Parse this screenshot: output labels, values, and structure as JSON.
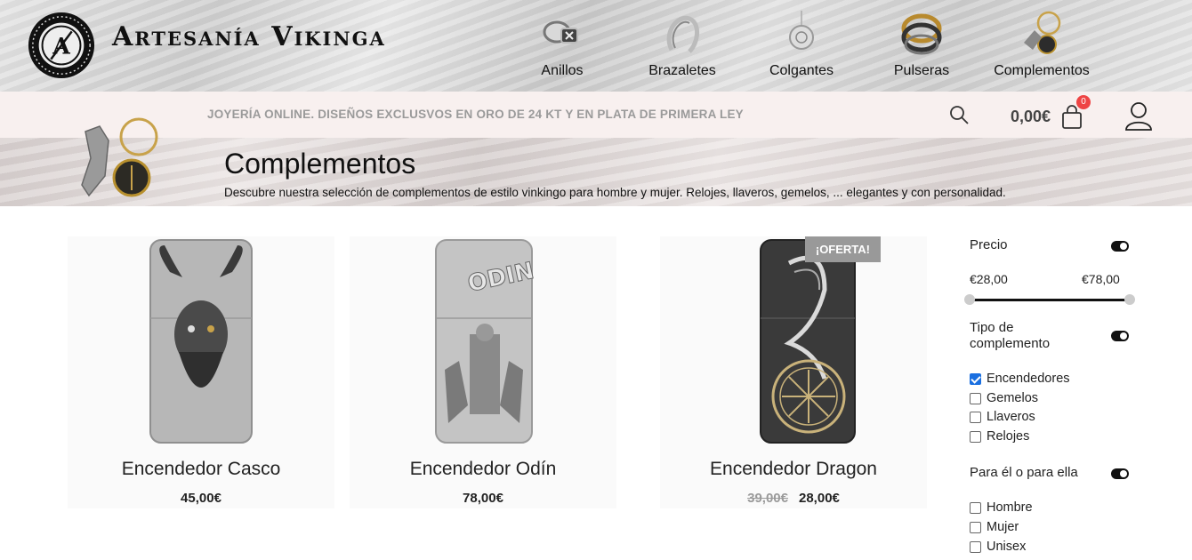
{
  "header": {
    "brand": "Artesanía Vikinga",
    "logo_icon": "viking-medallion-logo",
    "nav": [
      {
        "label": "Anillos",
        "icon": "rings-icon"
      },
      {
        "label": "Brazaletes",
        "icon": "bracelet-icon"
      },
      {
        "label": "Colgantes",
        "icon": "pendant-icon"
      },
      {
        "label": "Pulseras",
        "icon": "bangles-icon"
      },
      {
        "label": "Complementos",
        "icon": "accessories-icon"
      }
    ]
  },
  "topbar": {
    "tagline": "JOYERÍA ONLINE. DISEÑOS EXCLUSVOS EN ORO DE 24 KT Y EN PLATA DE PRIMERA LEY",
    "cart_total": "0,00€",
    "cart_count": "0",
    "icons": [
      "search-icon",
      "cart-icon",
      "user-icon"
    ]
  },
  "banner": {
    "title": "Complementos",
    "description": "Descubre nuestra selección de complementos de estilo vinkingo para hombre y mujer. Relojes, llaveros, gemelos, ... elegantes y con personalidad."
  },
  "products": [
    {
      "name": "Encendedor Casco",
      "price": "45,00€"
    },
    {
      "name": "Encendedor Odín",
      "price": "78,00€"
    },
    {
      "name": "Encendedor Dragon",
      "old_price": "39,00€",
      "price": "28,00€",
      "badge": "¡OFERTA!"
    }
  ],
  "filters": {
    "price": {
      "label": "Precio",
      "min": "€28,00",
      "max": "€78,00",
      "range_fraction": [
        0,
        1
      ]
    },
    "type": {
      "label": "Tipo de complemento",
      "options": [
        {
          "label": "Encendedores",
          "checked": true
        },
        {
          "label": "Gemelos",
          "checked": false
        },
        {
          "label": "Llaveros",
          "checked": false
        },
        {
          "label": "Relojes",
          "checked": false
        }
      ]
    },
    "gender": {
      "label": "Para él o para ella",
      "options": [
        {
          "label": "Hombre",
          "checked": false
        },
        {
          "label": "Mujer",
          "checked": false
        },
        {
          "label": "Unisex",
          "checked": false
        }
      ]
    }
  },
  "colors": {
    "topbar_bg": "#f8f0ef",
    "accent_badge": "#e44444",
    "sale_badge": "#999999",
    "checkbox_on": "#1a6fe0"
  }
}
